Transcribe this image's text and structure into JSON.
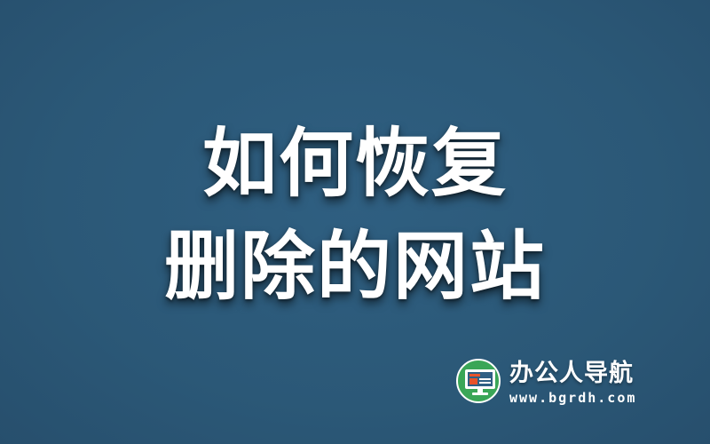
{
  "title": {
    "line1": "如何恢复",
    "line2": "删除的网站"
  },
  "brand": {
    "logo_icon": "monitor-icon",
    "name": "办公人导航",
    "url": "www.bgrdh.com"
  },
  "colors": {
    "background": "#2c5a7b",
    "title_text": "#ffffff",
    "logo_green": "#3aa657",
    "monitor_accent": "#e8522a"
  }
}
